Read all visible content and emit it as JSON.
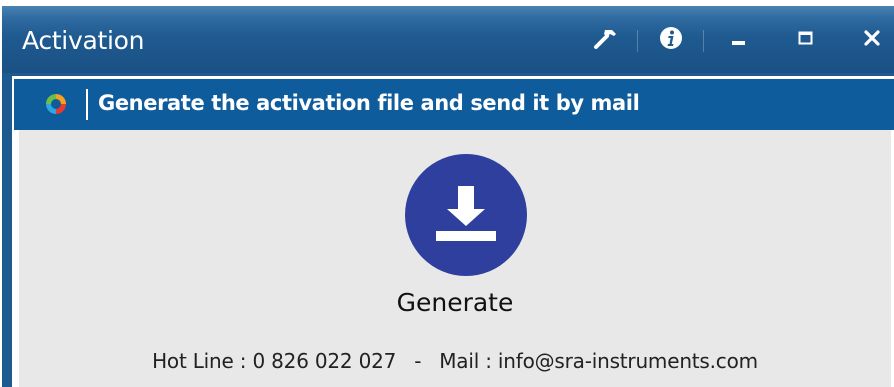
{
  "window": {
    "title": "Activation",
    "controls": [
      {
        "name": "hammer-icon"
      },
      {
        "name": "info-icon"
      },
      {
        "name": "minimize-icon"
      },
      {
        "name": "maximize-icon"
      },
      {
        "name": "close-icon"
      }
    ]
  },
  "header": {
    "logo_icon": "app-logo-icon",
    "text": "Generate the activation file and send it by mail"
  },
  "main": {
    "generate_icon": "download-icon",
    "generate_label": "Generate"
  },
  "footer": {
    "hotline": "Hot Line : 0 826 022 027",
    "separator": "-",
    "mail": "Mail : info@sra-instruments.com"
  },
  "colors": {
    "titlebar": "#1f5a90",
    "header_bar": "#0f5c9d",
    "content_bg": "#e8e8e8",
    "button": "#2f3f9e"
  }
}
